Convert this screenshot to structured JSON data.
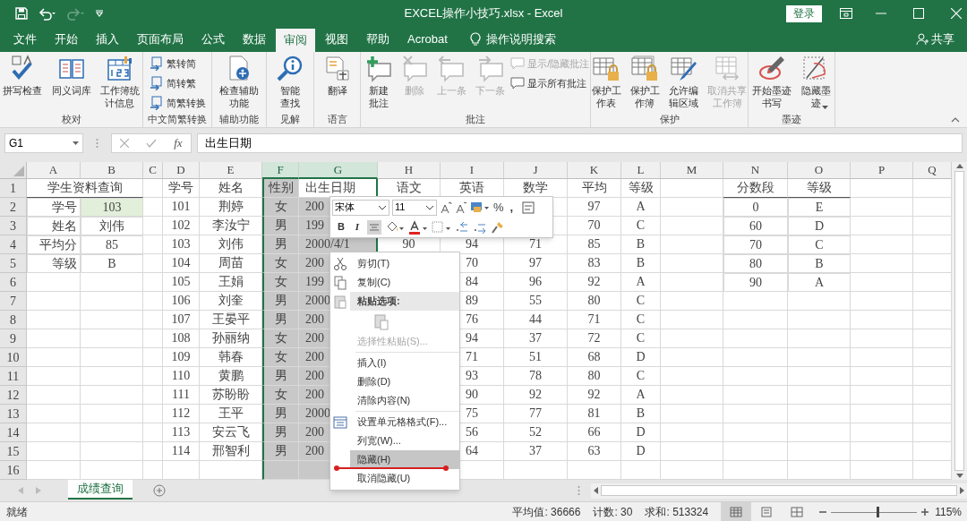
{
  "title_bar": {
    "title": "EXCEL操作小技巧.xlsx - Excel",
    "sign_in": "登录"
  },
  "menu_tabs": [
    {
      "label": "文件",
      "selected": false
    },
    {
      "label": "开始",
      "selected": false
    },
    {
      "label": "插入",
      "selected": false
    },
    {
      "label": "页面布局",
      "selected": false
    },
    {
      "label": "公式",
      "selected": false
    },
    {
      "label": "数据",
      "selected": false
    },
    {
      "label": "审阅",
      "selected": true
    },
    {
      "label": "视图",
      "selected": false
    },
    {
      "label": "帮助",
      "selected": false
    },
    {
      "label": "Acrobat",
      "selected": false
    }
  ],
  "tell_me": "操作说明搜索",
  "share": "共享",
  "ribbon_groups": [
    {
      "label": "校对",
      "buttons": [
        {
          "label": "拼写检查",
          "kind": "large",
          "disabled": false
        },
        {
          "label": "同义词库",
          "kind": "large",
          "disabled": false
        },
        {
          "label": "工作簿统计信息",
          "kind": "large",
          "disabled": false
        }
      ]
    },
    {
      "label": "中文简繁转换",
      "buttons": [
        {
          "label": "繁转简",
          "kind": "small",
          "disabled": false
        },
        {
          "label": "简转繁",
          "kind": "small",
          "disabled": false
        },
        {
          "label": "简繁转换",
          "kind": "small",
          "disabled": false
        }
      ]
    },
    {
      "label": "辅助功能",
      "buttons": [
        {
          "label": "检查辅助功能",
          "kind": "large",
          "disabled": false
        }
      ]
    },
    {
      "label": "见解",
      "buttons": [
        {
          "label": "智能查找",
          "kind": "large",
          "disabled": false
        }
      ]
    },
    {
      "label": "语言",
      "buttons": [
        {
          "label": "翻译",
          "kind": "large",
          "disabled": false
        }
      ]
    },
    {
      "label": "批注",
      "buttons": [
        {
          "label": "新建批注",
          "kind": "large",
          "disabled": false
        },
        {
          "label": "删除",
          "kind": "large",
          "disabled": true
        },
        {
          "label": "上一条",
          "kind": "large",
          "disabled": true
        },
        {
          "label": "下一条",
          "kind": "large",
          "disabled": true
        },
        {
          "label": "显示/隐藏批注",
          "kind": "small",
          "disabled": true
        },
        {
          "label": "显示所有批注",
          "kind": "small",
          "disabled": false
        }
      ]
    },
    {
      "label": "保护",
      "buttons": [
        {
          "label": "保护工作表",
          "kind": "large",
          "disabled": false
        },
        {
          "label": "保护工作簿",
          "kind": "large",
          "disabled": false
        },
        {
          "label": "允许编辑区域",
          "kind": "large",
          "disabled": false
        },
        {
          "label": "取消共享工作簿",
          "kind": "large",
          "disabled": true
        }
      ]
    },
    {
      "label": "墨迹",
      "buttons": [
        {
          "label": "开始墨迹书写",
          "kind": "large",
          "disabled": false
        },
        {
          "label": "隐藏墨迹",
          "kind": "large",
          "disabled": false,
          "dropdown": true
        }
      ]
    }
  ],
  "formula_bar": {
    "name_box": "G1",
    "fx": "fx",
    "formula": "出生日期"
  },
  "columns": [
    {
      "label": "A",
      "selected": false
    },
    {
      "label": "B",
      "selected": false
    },
    {
      "label": "C",
      "selected": false
    },
    {
      "label": "D",
      "selected": false
    },
    {
      "label": "E",
      "selected": false
    },
    {
      "label": "F",
      "selected": true
    },
    {
      "label": "G",
      "selected": true,
      "active": true
    },
    {
      "label": "H",
      "selected": false
    },
    {
      "label": "I",
      "selected": false
    },
    {
      "label": "J",
      "selected": false
    },
    {
      "label": "K",
      "selected": false
    },
    {
      "label": "L",
      "selected": false
    },
    {
      "label": "M",
      "selected": false
    },
    {
      "label": "N",
      "selected": false
    },
    {
      "label": "O",
      "selected": false
    },
    {
      "label": "P",
      "selected": false
    },
    {
      "label": "Q",
      "selected": false
    }
  ],
  "rows": [
    {
      "number": "1",
      "active": true,
      "cells": [
        "学生资料查询",
        null,
        null,
        "学号",
        "姓名",
        "性别",
        "出生日期",
        "语文",
        "英语",
        "数学",
        "平均",
        "等级",
        null,
        "分数段",
        "等级"
      ]
    },
    {
      "number": "2",
      "cells": [
        "学号",
        "103",
        null,
        "101",
        "荆婷",
        "女",
        "200",
        null,
        null,
        null,
        "97",
        "A",
        null,
        "0",
        "E"
      ]
    },
    {
      "number": "3",
      "cells": [
        "姓名",
        "刘伟",
        null,
        "102",
        "李汝宁",
        "男",
        "199",
        null,
        null,
        null,
        "70",
        "C",
        null,
        "60",
        "D"
      ]
    },
    {
      "number": "4",
      "cells": [
        "平均分",
        "85",
        null,
        "103",
        "刘伟",
        "男",
        "2000/4/1",
        "90",
        "94",
        "71",
        "85",
        "B",
        null,
        "70",
        "C"
      ]
    },
    {
      "number": "5",
      "cells": [
        "等级",
        "B",
        null,
        "104",
        "周苗",
        "女",
        "200",
        null,
        "70",
        "97",
        "83",
        "B",
        null,
        "80",
        "B"
      ]
    },
    {
      "number": "6",
      "cells": [
        null,
        null,
        null,
        "105",
        "王娟",
        "女",
        "199",
        null,
        "84",
        "96",
        "92",
        "A",
        null,
        "90",
        "A"
      ]
    },
    {
      "number": "7",
      "cells": [
        null,
        null,
        null,
        "106",
        "刘奎",
        "男",
        "2000",
        null,
        "89",
        "55",
        "80",
        "C"
      ]
    },
    {
      "number": "8",
      "cells": [
        null,
        null,
        null,
        "107",
        "王晏平",
        "男",
        "200",
        null,
        "76",
        "44",
        "71",
        "C"
      ]
    },
    {
      "number": "9",
      "cells": [
        null,
        null,
        null,
        "108",
        "孙丽纳",
        "女",
        "200",
        null,
        "94",
        "37",
        "72",
        "C"
      ]
    },
    {
      "number": "10",
      "cells": [
        null,
        null,
        null,
        "109",
        "韩春",
        "女",
        "200",
        null,
        "71",
        "51",
        "68",
        "D"
      ]
    },
    {
      "number": "11",
      "cells": [
        null,
        null,
        null,
        "110",
        "黄鹏",
        "男",
        "200",
        null,
        "93",
        "78",
        "80",
        "C"
      ]
    },
    {
      "number": "12",
      "cells": [
        null,
        null,
        null,
        "111",
        "苏盼盼",
        "女",
        "200",
        null,
        "90",
        "92",
        "92",
        "A"
      ]
    },
    {
      "number": "13",
      "cells": [
        null,
        null,
        null,
        "112",
        "王平",
        "男",
        "2000",
        null,
        "75",
        "77",
        "81",
        "B"
      ]
    },
    {
      "number": "14",
      "cells": [
        null,
        null,
        null,
        "113",
        "安云飞",
        "男",
        "200",
        null,
        "56",
        "52",
        "66",
        "D"
      ]
    },
    {
      "number": "15",
      "cells": [
        null,
        null,
        null,
        "114",
        "邢智利",
        "男",
        "200",
        null,
        "64",
        "37",
        "63",
        "D"
      ]
    },
    {
      "number": "16"
    }
  ],
  "mini_toolbar": {
    "font": "宋体",
    "size": "11",
    "percent": "%",
    "comma": ",",
    "bold": "B",
    "italic": "I"
  },
  "context_menu": [
    {
      "kind": "command",
      "label": "剪切(T)",
      "disabled": false,
      "selected": false
    },
    {
      "kind": "command",
      "label": "复制(C)",
      "disabled": false,
      "selected": false
    },
    {
      "kind": "header",
      "label": "粘贴选项:"
    },
    {
      "kind": "paste_options"
    },
    {
      "kind": "command",
      "label": "选择性粘贴(S)...",
      "disabled": true,
      "selected": false
    },
    {
      "kind": "separator"
    },
    {
      "kind": "command",
      "label": "插入(I)",
      "disabled": false,
      "selected": false
    },
    {
      "kind": "command",
      "label": "删除(D)",
      "disabled": false,
      "selected": false
    },
    {
      "kind": "command",
      "label": "清除内容(N)",
      "disabled": false,
      "selected": false
    },
    {
      "kind": "separator"
    },
    {
      "kind": "command",
      "label": "设置单元格格式(F)...",
      "disabled": false,
      "selected": false
    },
    {
      "kind": "command",
      "label": "列宽(W)...",
      "disabled": false,
      "selected": false
    },
    {
      "kind": "command",
      "label": "隐藏(H)",
      "disabled": false,
      "selected": true
    },
    {
      "kind": "command",
      "label": "取消隐藏(U)",
      "disabled": false,
      "selected": false
    }
  ],
  "sheet_tabs": [
    {
      "label": "成绩查询",
      "selected": true
    }
  ],
  "status_bar": {
    "state": "就绪",
    "average": "平均值: 36666",
    "count": "计数: 30",
    "sum": "求和: 513324",
    "views": [
      {
        "selected": true
      },
      {
        "selected": false
      },
      {
        "selected": false
      }
    ],
    "zoom_slider": {
      "level": 0.55
    },
    "zoom": "115%"
  }
}
